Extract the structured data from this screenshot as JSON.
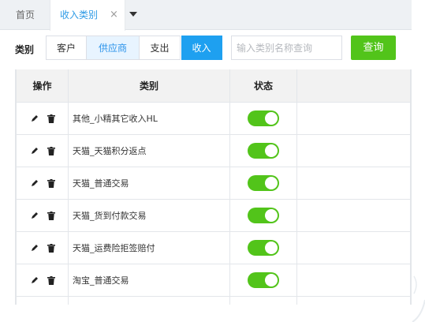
{
  "tabs": {
    "home": "首页",
    "active": "收入类别",
    "close": "×"
  },
  "filter": {
    "label": "类别",
    "segments": {
      "customer": "客户",
      "supplier": "供应商",
      "expense": "支出",
      "income": "收入"
    },
    "search_placeholder": "输入类别名称查询",
    "query_button": "查询"
  },
  "table": {
    "headers": {
      "ops": "操作",
      "category": "类别",
      "status": "状态"
    },
    "rows": [
      {
        "name": "其他_小精其它收入HL",
        "enabled": true
      },
      {
        "name": "天猫_天猫积分返点",
        "enabled": true
      },
      {
        "name": "天猫_普通交易",
        "enabled": true
      },
      {
        "name": "天猫_货到付款交易",
        "enabled": true
      },
      {
        "name": "天猫_运费险拒签赔付",
        "enabled": true
      },
      {
        "name": "淘宝_普通交易",
        "enabled": true
      },
      {
        "name": "",
        "enabled": false
      }
    ]
  },
  "colors": {
    "accent_blue": "#1ea0f0",
    "query_green": "#52c41a",
    "toggle_on": "#52c41a"
  },
  "icons": {
    "edit": "edit-icon",
    "delete": "trash-icon",
    "tab_menu": "chevron-down-icon"
  }
}
